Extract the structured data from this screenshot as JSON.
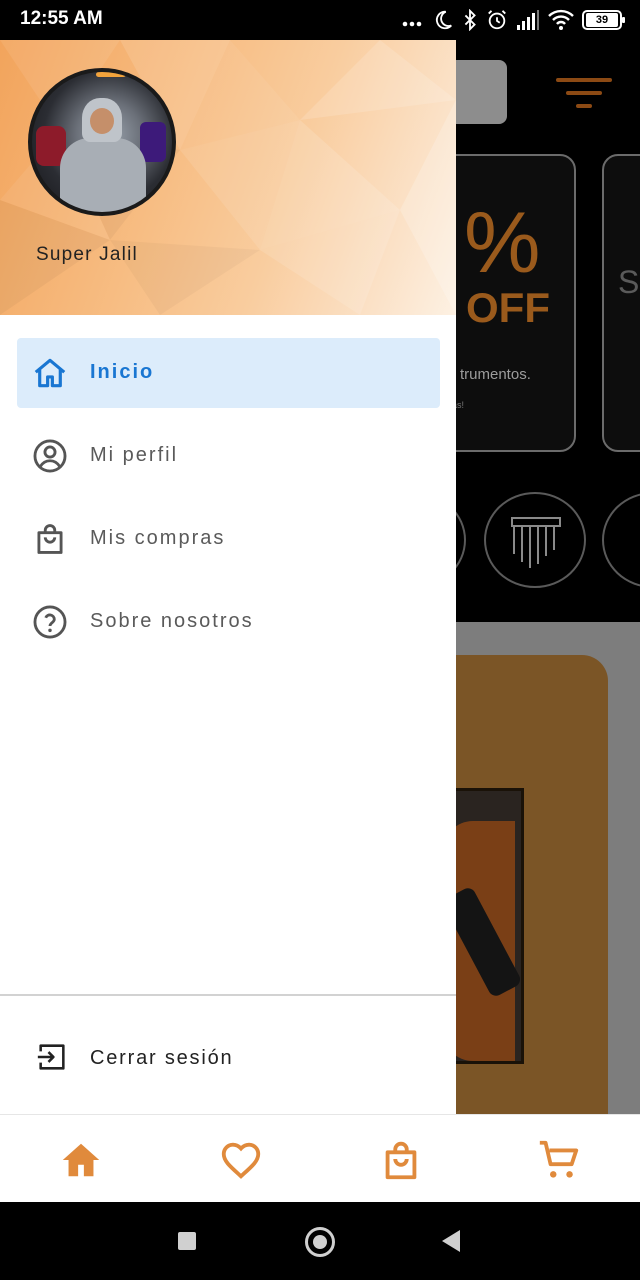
{
  "status_bar": {
    "time": "12:55 AM",
    "battery": "39",
    "icons": [
      "more-dots-icon",
      "moon-icon",
      "bluetooth-icon",
      "alarm-icon",
      "signal-icon",
      "wifi-icon",
      "battery-icon"
    ]
  },
  "drawer": {
    "user_name": "Super Jalil",
    "menu": [
      {
        "label": "Inicio",
        "icon": "home-icon",
        "active": true
      },
      {
        "label": "Mi perfil",
        "icon": "account-circle-icon",
        "active": false
      },
      {
        "label": "Mis compras",
        "icon": "shopping-bag-icon",
        "active": false
      },
      {
        "label": "Sobre nosotros",
        "icon": "help-circle-icon",
        "active": false
      }
    ],
    "logout_label": "Cerrar sesión",
    "logout_icon": "logout-icon"
  },
  "background": {
    "promo_percent": "%",
    "promo_off": "OFF",
    "promo_text": "trumentos.",
    "promo_text_small": "as!"
  },
  "bottom_nav": {
    "items": [
      "home-icon",
      "heart-icon",
      "shopping-bag-icon",
      "cart-icon"
    ]
  },
  "colors": {
    "accent": "#e08a3c",
    "active_bg": "#dcecfb",
    "active_text": "#1976d2"
  }
}
